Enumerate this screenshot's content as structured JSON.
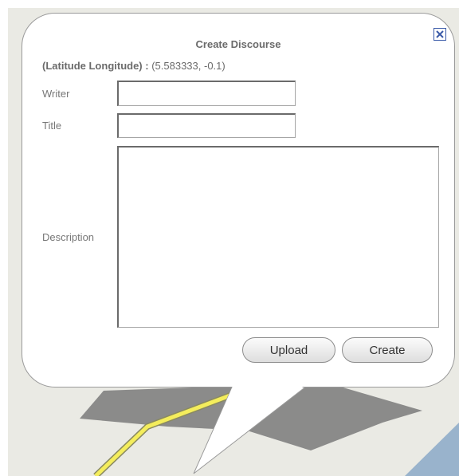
{
  "dialog": {
    "title": "Create Discourse",
    "coords_label": "(Latitude Longitude) :",
    "coords_value": "(5.583333, -0.1)",
    "close_icon": "close-x-icon"
  },
  "form": {
    "writer_label": "Writer",
    "writer_value": "",
    "title_label": "Title",
    "title_value": "",
    "description_label": "Description",
    "description_value": ""
  },
  "buttons": {
    "upload_label": "Upload",
    "create_label": "Create"
  },
  "colors": {
    "map_land": "#eaeae4",
    "map_water": "#99b3cc",
    "road": "#f4ed5c",
    "close_icon": "#3a5aa8"
  }
}
